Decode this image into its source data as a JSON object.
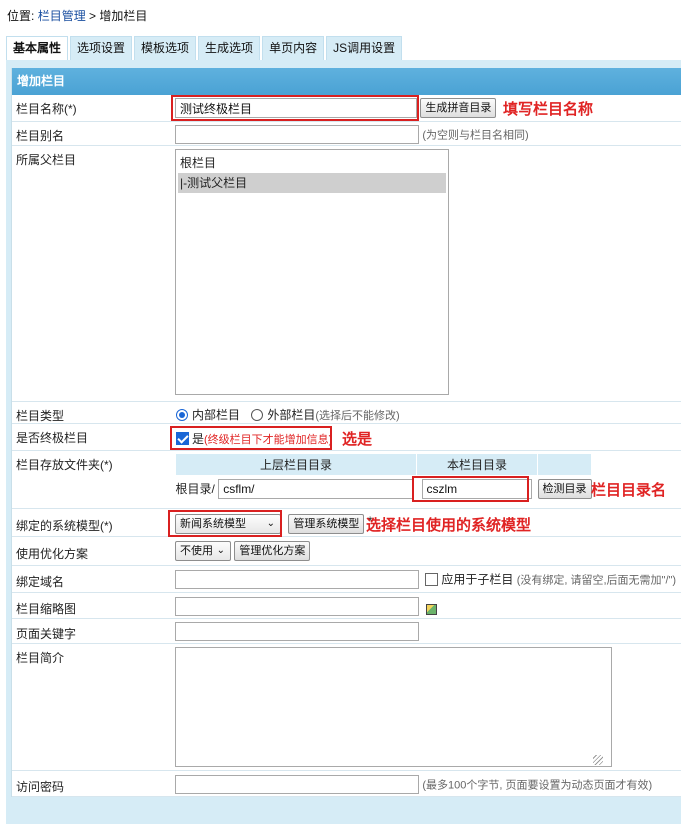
{
  "breadcrumb": {
    "prefix": "位置:",
    "section": "栏目管理",
    "sep": ">",
    "current": "增加栏目"
  },
  "tabs": [
    "基本属性",
    "选项设置",
    "模板选项",
    "生成选项",
    "单页内容",
    "JS调用设置"
  ],
  "panel_title": "增加栏目",
  "fields": {
    "name": {
      "label": "栏目名称(*)",
      "value": "测试终极栏目",
      "button": "生成拼音目录",
      "annotation": "填写栏目名称"
    },
    "alias": {
      "label": "栏目别名",
      "value": "",
      "hint": "(为空则与栏目名相同)"
    },
    "parent": {
      "label": "所属父栏目",
      "options": [
        "根栏目",
        "|-测试父栏目"
      ],
      "selected_index": 1
    },
    "type": {
      "label": "栏目类型",
      "option_internal": "内部栏目",
      "option_external": "外部栏目",
      "hint": "(选择后不能修改)",
      "selected": "内部栏目"
    },
    "final": {
      "label": "是否终极栏目",
      "checkbox_label": "是",
      "hint": "(终级栏目下才能增加信息)",
      "checked": true,
      "annotation": "选是"
    },
    "folder": {
      "label": "栏目存放文件夹(*)",
      "col_upper": "上层栏目目录",
      "col_this": "本栏目目录",
      "prefix": "根目录/",
      "upper_value": "csflm/",
      "this_value": "cszlm",
      "button": "检测目录",
      "annotation": "栏目目录名"
    },
    "model": {
      "label": "绑定的系统模型(*)",
      "value": "新闻系统模型",
      "button": "管理系统模型",
      "star": "*",
      "annotation": "选择栏目使用的系统模型"
    },
    "optimize": {
      "label": "使用优化方案",
      "value": "不使用",
      "button": "管理优化方案"
    },
    "domain": {
      "label": "绑定域名",
      "value": "",
      "checkbox_label": "应用于子栏目",
      "hint": "(没有绑定, 请留空,后面无需加\"/\")"
    },
    "thumb": {
      "label": "栏目缩略图",
      "value": ""
    },
    "keywords": {
      "label": "页面关键字",
      "value": ""
    },
    "intro": {
      "label": "栏目简介",
      "value": ""
    },
    "password": {
      "label": "访问密码",
      "value": "",
      "hint": "(最多100个字节, 页面要设置为动态页面才有效)"
    }
  },
  "colors": {
    "accent": "#4aa2d4",
    "tab_bg": "#d6ecf6",
    "annotation": "#e02424"
  }
}
